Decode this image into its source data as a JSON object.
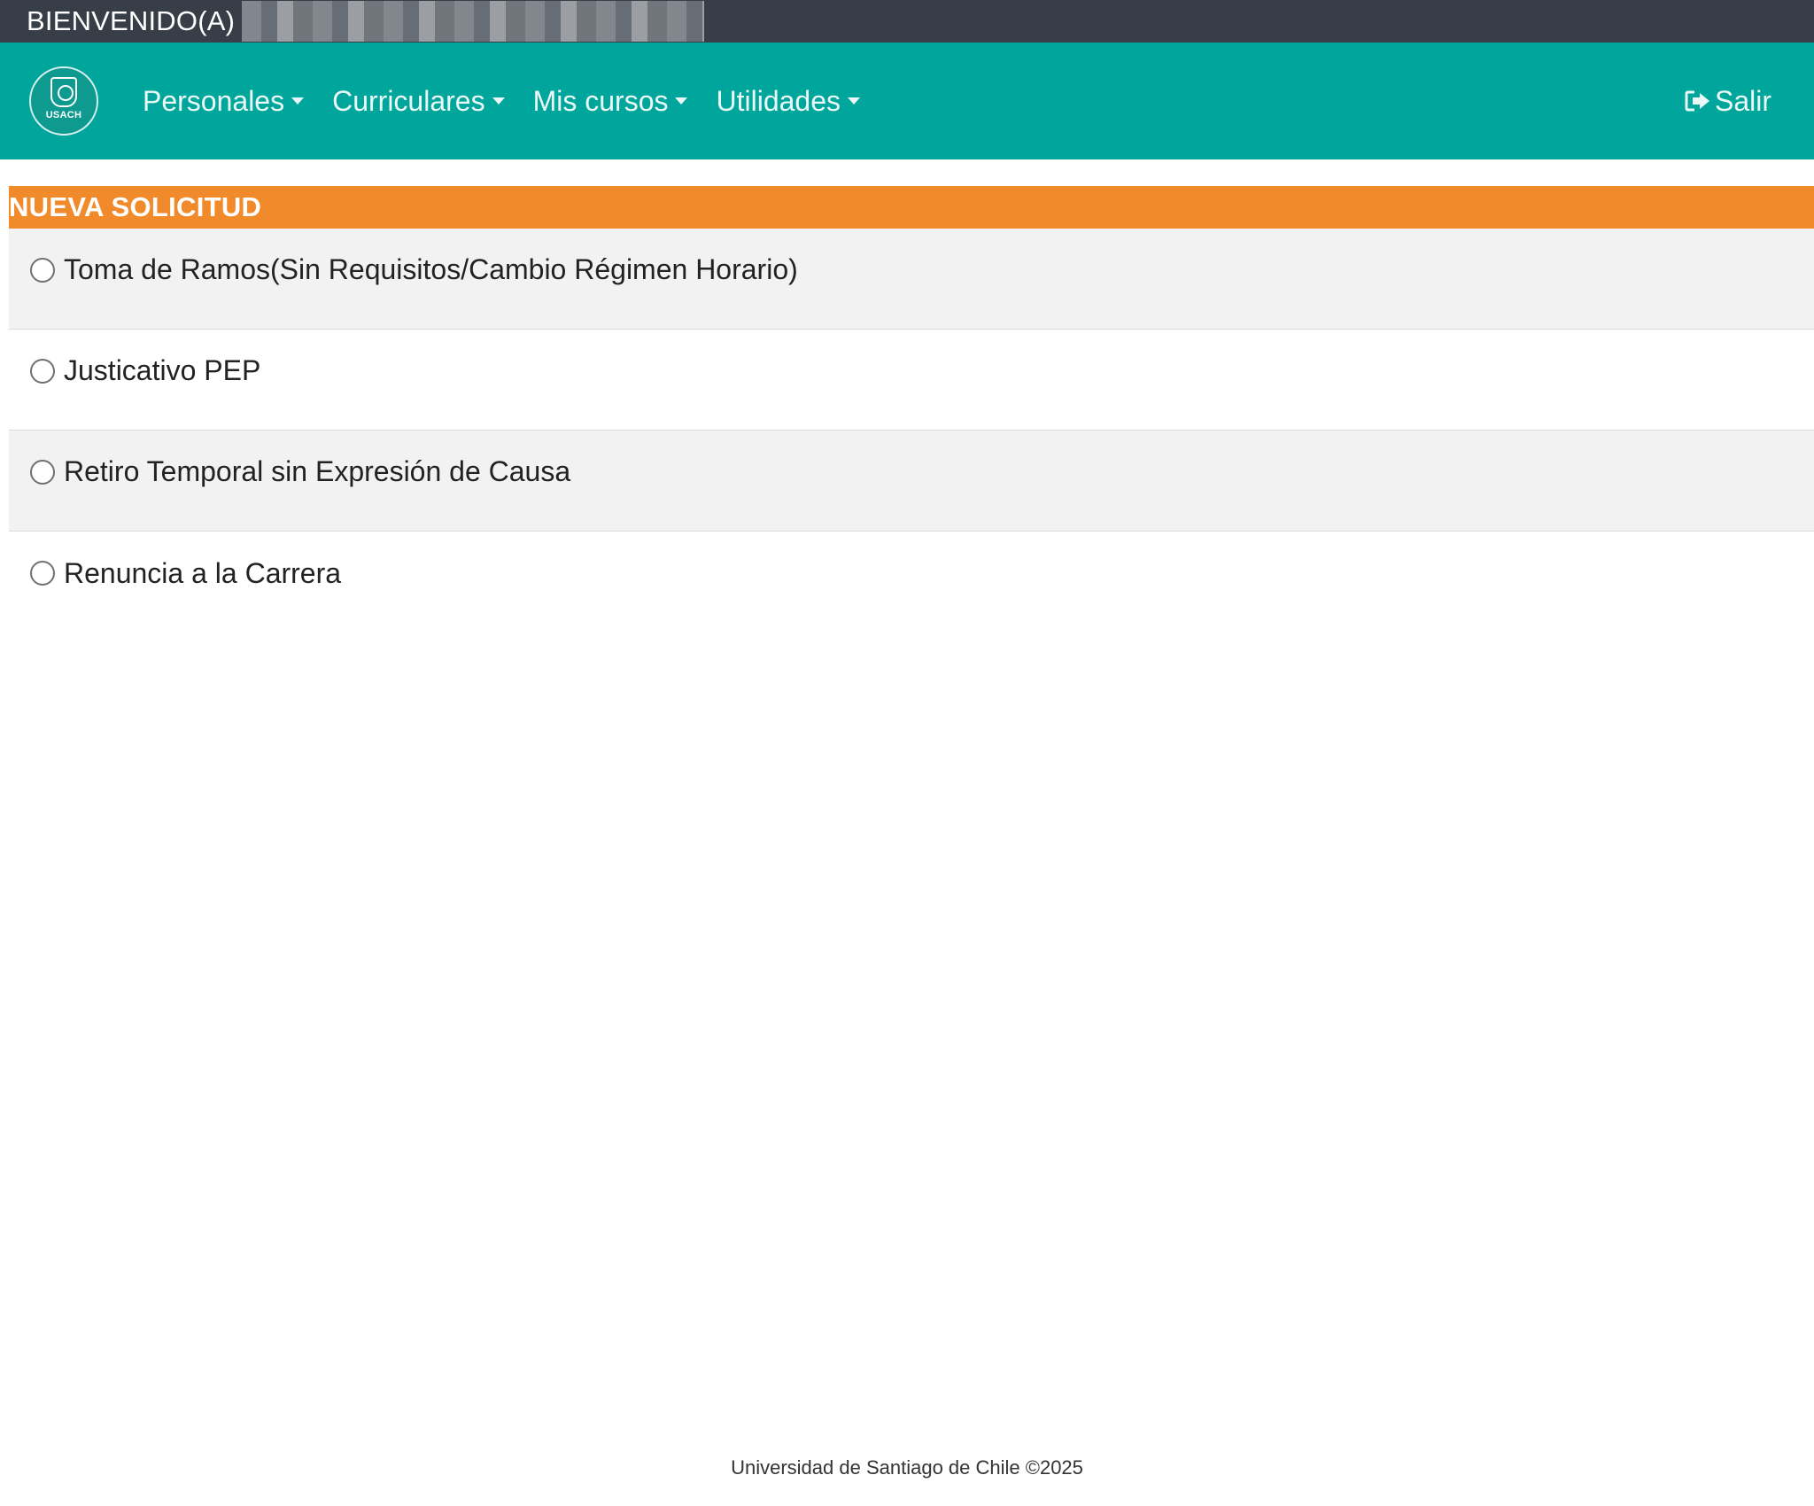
{
  "topbar": {
    "welcome_label": "BIENVENIDO(A)"
  },
  "navbar": {
    "logo_text": "USACH",
    "menu": [
      {
        "label": "Personales"
      },
      {
        "label": "Curriculares"
      },
      {
        "label": "Mis cursos"
      },
      {
        "label": "Utilidades"
      }
    ],
    "logout_label": "Salir"
  },
  "section": {
    "title": "NUEVA SOLICITUD",
    "options": [
      {
        "label": "Toma de Ramos(Sin Requisitos/Cambio Régimen Horario)",
        "selected": false
      },
      {
        "label": "Justicativo PEP",
        "selected": false
      },
      {
        "label": "Retiro Temporal sin Expresión de Causa",
        "selected": false
      },
      {
        "label": "Renuncia a la Carrera",
        "selected": false
      }
    ]
  },
  "footer": {
    "text": "Universidad de Santiago de Chile ©2025"
  },
  "colors": {
    "topbar": "#373e47",
    "navbar": "#00a69c",
    "section_header": "#f08a2a",
    "stripe": "#f2f2f2"
  },
  "icons": {
    "caret": "caret-down-icon",
    "logout": "sign-out-icon",
    "radio": "radio-unchecked-icon"
  }
}
